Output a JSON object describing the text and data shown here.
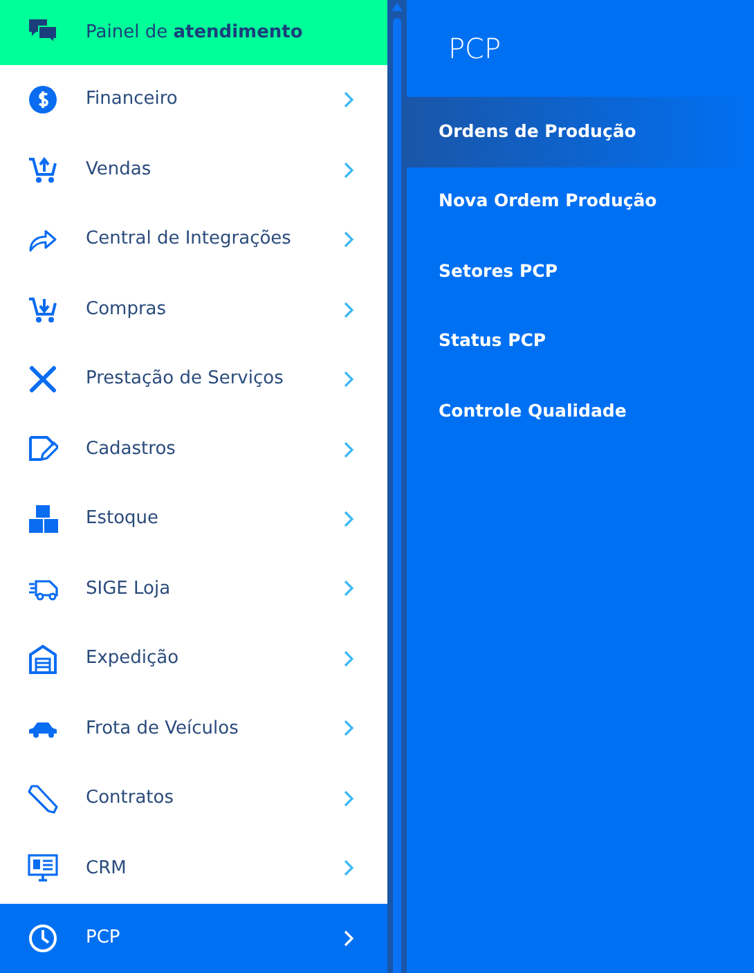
{
  "header": {
    "text": "Painel de **atendimento**"
  },
  "menu": [
    {
      "label": "Financeiro",
      "selected": false
    },
    {
      "label": "Vendas",
      "selected": false
    },
    {
      "label": "Central de Integrações",
      "selected": false
    },
    {
      "label": "Compras",
      "selected": false
    },
    {
      "label": "Prestação de Serviços",
      "selected": false
    },
    {
      "label": "Cadastros",
      "selected": false
    },
    {
      "label": "Estoque",
      "selected": false
    },
    {
      "label": "SIGE Loja",
      "selected": false
    },
    {
      "label": "Expedição",
      "selected": false
    },
    {
      "label": "Frota de Veículos",
      "selected": false
    },
    {
      "label": "Contratos",
      "selected": false
    },
    {
      "label": "CRM",
      "selected": false
    },
    {
      "label": "PCP",
      "selected": true
    }
  ],
  "submenu": {
    "title": "PCP",
    "items": [
      {
        "label": "Ordens de Produção",
        "selected": true
      },
      {
        "label": "Nova Ordem Produção",
        "selected": false
      },
      {
        "label": "Setores PCP",
        "selected": false
      },
      {
        "label": "Status PCP",
        "selected": false
      },
      {
        "label": "Controle Qualidade",
        "selected": false
      }
    ]
  }
}
